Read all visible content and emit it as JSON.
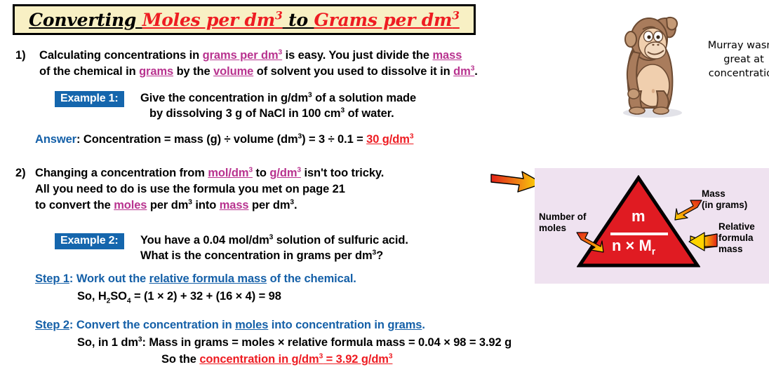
{
  "title": {
    "part1": "Converting ",
    "part2": "Moles per dm",
    "part2_sup": "3",
    "part3": " to ",
    "part4": "Grams per dm",
    "part4_sup": "3"
  },
  "colors": {
    "title_bg": "#f8f0c4",
    "title_red": "#ee1c22",
    "keyword_magenta": "#b8338f",
    "heading_blue": "#1566ad",
    "answer_red": "#ee1c22",
    "panel_bg": "#efe2f0",
    "triangle_red": "#e01b22"
  },
  "point1": {
    "number": "1)",
    "line1_a": "Calculating concentrations in ",
    "line1_kw": "grams per dm",
    "line1_kw_sup": "3",
    "line1_b": " is easy.  You just divide the ",
    "line1_kw2": "mass",
    "line2_a": "of the chemical in ",
    "line2_kw": "grams",
    "line2_b": " by the ",
    "line2_kw2": "volume",
    "line2_c": " of solvent you used to dissolve it in ",
    "line2_kw3": "dm",
    "line2_kw3_sup": "3",
    "line2_d": "."
  },
  "example1": {
    "chip": "Example 1:",
    "line1_a": "Give the concentration in g/dm",
    "line1_sup": "3",
    "line1_b": " of a solution made",
    "line2_a": "by dissolving 3 g of NaCl in 100 cm",
    "line2_sup": "3",
    "line2_b": " of water."
  },
  "answer1": {
    "label": "Answer",
    "colon": ": ",
    "body_a": "Concentration = mass (g) ÷ volume (dm",
    "body_sup": "3",
    "body_b": ") = 3 ÷ 0.1 = ",
    "result": "30 g/dm",
    "result_sup": "3"
  },
  "point2": {
    "number": "2)",
    "line1_a": "Changing a concentration from ",
    "line1_kw": "mol/dm",
    "line1_kw_sup": "3",
    "line1_b": " to ",
    "line1_kw2": "g/dm",
    "line1_kw2_sup": "3",
    "line1_c": " isn't too tricky.",
    "line2": "All you need to do is use the formula you met on page 21",
    "line3_a": "to convert the ",
    "line3_kw": "moles",
    "line3_b": " per dm",
    "line3_sup": "3",
    "line3_c": " into ",
    "line3_kw2": "mass",
    "line3_d": " per dm",
    "line3_sup2": "3",
    "line3_e": "."
  },
  "example2": {
    "chip": "Example 2:",
    "line1_a": "You have a 0.04 mol/dm",
    "line1_sup": "3",
    "line1_b": " solution of sulfuric acid.",
    "line2_a": "What is the concentration in grams per dm",
    "line2_sup": "3",
    "line2_b": "?"
  },
  "step1": {
    "label": "Step 1",
    "colon": ": ",
    "text_a": "Work out the ",
    "kw": "relative formula mass",
    "text_b": " of the chemical.",
    "formula_a": "So, H",
    "formula_sub1": "2",
    "formula_b": "SO",
    "formula_sub2": "4",
    "formula_c": " = (1 × 2) + 32 + (16 × 4) = 98"
  },
  "step2": {
    "label": "Step 2",
    "colon": ": ",
    "text_a": "Convert the concentration in ",
    "kw": "moles",
    "text_b": " into concentration in ",
    "kw2": "grams",
    "text_c": ".",
    "calc_a": "So, in 1 dm",
    "calc_sup": "3",
    "calc_b": ":  Mass in grams = moles × relative formula mass = 0.04 × 98 = 3.92 g",
    "final_a": "So the ",
    "final_result": "concentration in g/dm",
    "final_result_sup": "3",
    "final_result_b": " = 3.92 g/dm",
    "final_result_sup2": "3"
  },
  "formula_panel": {
    "numerator": "m",
    "denominator": "n × M",
    "denominator_sub": "r",
    "label_left_line1": "Number of",
    "label_left_line2": "moles",
    "label_top_right_line1": "Mass",
    "label_top_right_line2": "(in grams)",
    "label_bottom_right_line1": "Relative",
    "label_bottom_right_line2": "formula",
    "label_bottom_right_line3": "mass"
  },
  "cartoon": {
    "caption_line1": "Murray wasn't",
    "caption_line2": "great at",
    "caption_line3": "concentration"
  }
}
